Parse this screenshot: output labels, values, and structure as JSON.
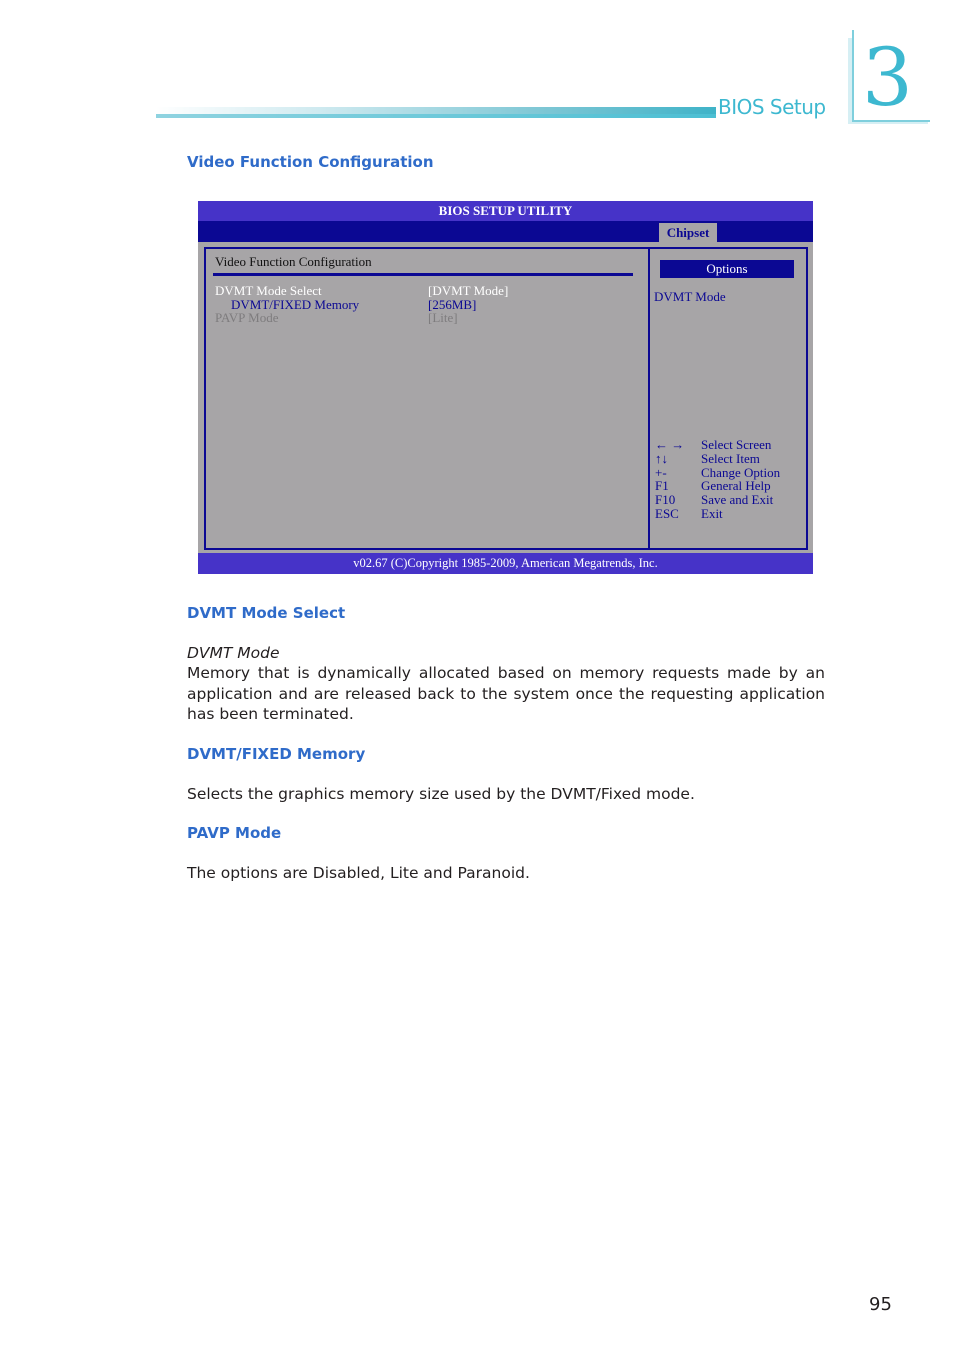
{
  "header": {
    "section_title": "BIOS Setup",
    "chapter_number": "3"
  },
  "page_heading": "Video Function Configuration",
  "bios": {
    "title": "BIOS SETUP UTILITY",
    "active_tab": "Chipset",
    "section": "Video Function Configuration",
    "items": [
      {
        "label": "DVMT Mode Select",
        "value": "[DVMT Mode]",
        "state": "normal"
      },
      {
        "label": "DVMT/FIXED Memory",
        "value": "[256MB]",
        "state": "selected"
      },
      {
        "label": "PAVP Mode",
        "value": "[Lite]",
        "state": "disabled"
      }
    ],
    "options_header": "Options",
    "options_help": "DVMT Mode",
    "keys": [
      {
        "key": "← →",
        "action": "Select Screen"
      },
      {
        "key": "↑↓",
        "action": "Select Item"
      },
      {
        "key": "+-",
        "action": "Change Option"
      },
      {
        "key": "F1",
        "action": "General Help"
      },
      {
        "key": "F10",
        "action": "Save and Exit"
      },
      {
        "key": "ESC",
        "action": "Exit"
      }
    ],
    "footer": "v02.67 (C)Copyright 1985-2009, American Megatrends, Inc.",
    "colors": {
      "title_bar": "#4633c8",
      "tab_bar": "#0b0893",
      "panel": "#a7a5a7"
    }
  },
  "sections": [
    {
      "heading": "DVMT Mode Select",
      "subheading": "DVMT Mode",
      "text": "Memory that is dynamically allocated based on memory requests made by an application and are released back to the system once the requesting application has been terminated."
    },
    {
      "heading": "DVMT/FIXED Memory",
      "text": "Selects the graphics memory size used by the DVMT/Fixed mode."
    },
    {
      "heading": "PAVP Mode",
      "text": "The options are Disabled, Lite and Paranoid."
    }
  ],
  "page_number": "95",
  "accent_color": "#2f6bc9"
}
